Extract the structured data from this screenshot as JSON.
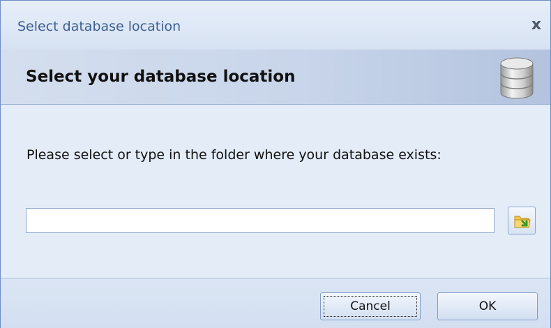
{
  "window": {
    "title": "Select database location",
    "close_glyph": "x"
  },
  "header": {
    "title": "Select your database location",
    "icon": "database-icon"
  },
  "content": {
    "prompt": "Please select or type in the folder where your database exists:",
    "path_input": {
      "value": "",
      "placeholder": ""
    },
    "browse_icon": "folder-browse-icon"
  },
  "footer": {
    "cancel_label": "Cancel",
    "ok_label": "OK"
  },
  "colors": {
    "title_text": "#3e5f8f",
    "header_band": "#c8d5ea",
    "dialog_bg": "#e4ecf8",
    "border": "#6b8fc6"
  }
}
